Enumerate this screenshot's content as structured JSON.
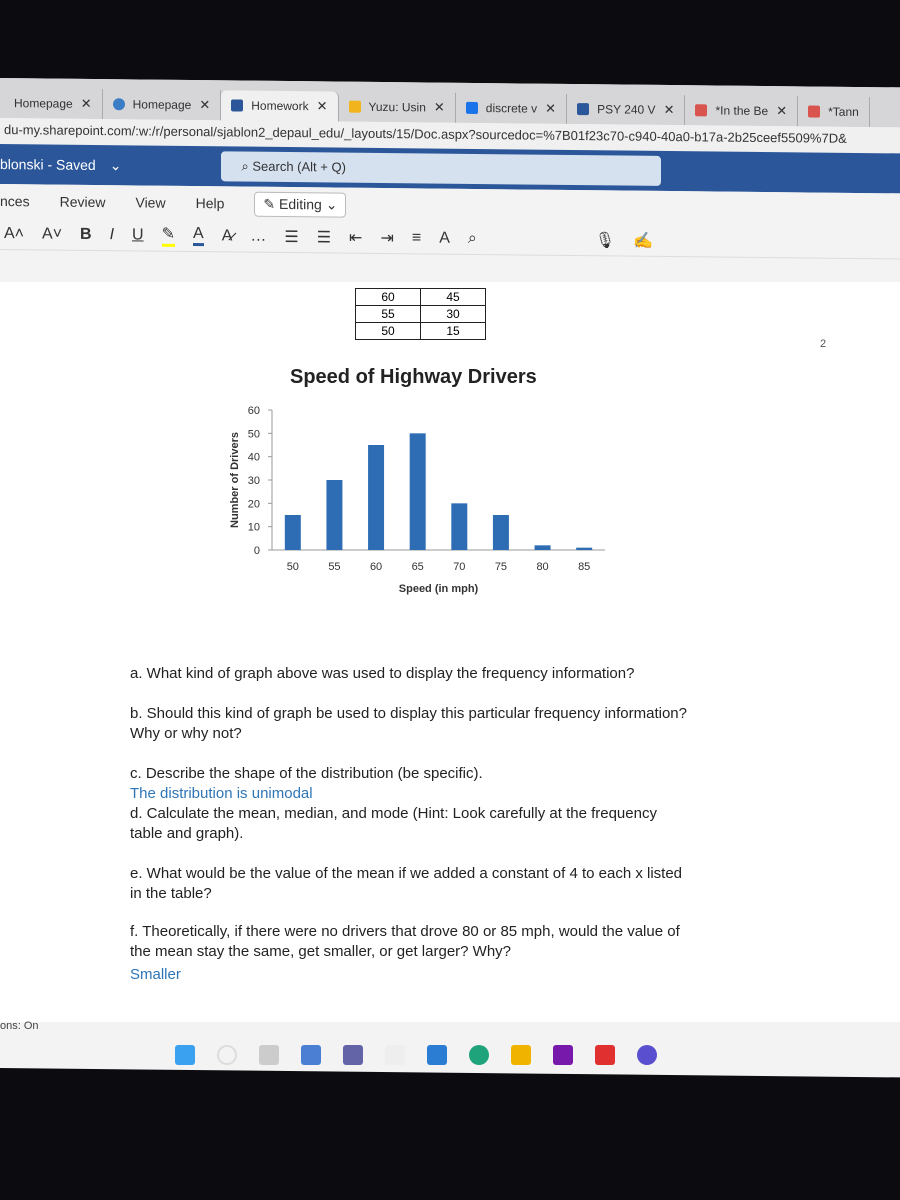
{
  "browser": {
    "tabs": [
      {
        "label": "Homepage",
        "active": false
      },
      {
        "label": "Homepage",
        "active": false
      },
      {
        "label": "Homework",
        "active": true
      },
      {
        "label": "Yuzu: Usin",
        "active": false
      },
      {
        "label": "discrete v",
        "active": false
      },
      {
        "label": "PSY 240 V",
        "active": false
      },
      {
        "label": "*In the Be",
        "active": false
      },
      {
        "label": "*Tann",
        "active": false
      }
    ],
    "url": "du-my.sharepoint.com/:w:/r/personal/sjablon2_depaul_edu/_layouts/15/Doc.aspx?sourcedoc=%7B01f23c70-c940-40a0-b17a-2b25ceef5509%7D&"
  },
  "word": {
    "doc_status": "blonski - Saved",
    "search_placeholder": "Search (Alt + Q)",
    "menu": [
      "nces",
      "Review",
      "View",
      "Help"
    ],
    "editing": "Editing",
    "page_number": "2",
    "status_text": "ons: On"
  },
  "table": {
    "rows": [
      [
        "60",
        "45"
      ],
      [
        "55",
        "30"
      ],
      [
        "50",
        "15"
      ]
    ]
  },
  "chart_data": {
    "type": "bar",
    "title": "Speed of Highway Drivers",
    "xlabel": "Speed (in mph)",
    "ylabel": "Number of Drivers",
    "categories": [
      "50",
      "55",
      "60",
      "65",
      "70",
      "75",
      "80",
      "85"
    ],
    "values": [
      15,
      30,
      45,
      50,
      20,
      15,
      2,
      1
    ],
    "ylim": [
      0,
      60
    ],
    "yticks": [
      "0",
      "10",
      "20",
      "30",
      "40",
      "50",
      "60"
    ],
    "color": "#2e6db4",
    "grid": false
  },
  "questions": {
    "a": "a. What kind of graph above was used to display the frequency information?",
    "b": "b. Should this kind of graph be used to display this particular frequency information? Why or why not?",
    "c": "c. Describe the shape of the distribution (be specific).",
    "c_answer": "The distribution is unimodal",
    "d": "d. Calculate the mean, median, and mode (Hint: Look carefully at the frequency table and graph).",
    "e": "e. What would be the value of the mean if we added a constant of 4 to each x listed in the table?",
    "f": "f. Theoretically, if there were no drivers that drove 80 or 85 mph, would the value of the mean stay the same, get smaller, or get larger? Why?",
    "f_answer": "Smaller"
  }
}
